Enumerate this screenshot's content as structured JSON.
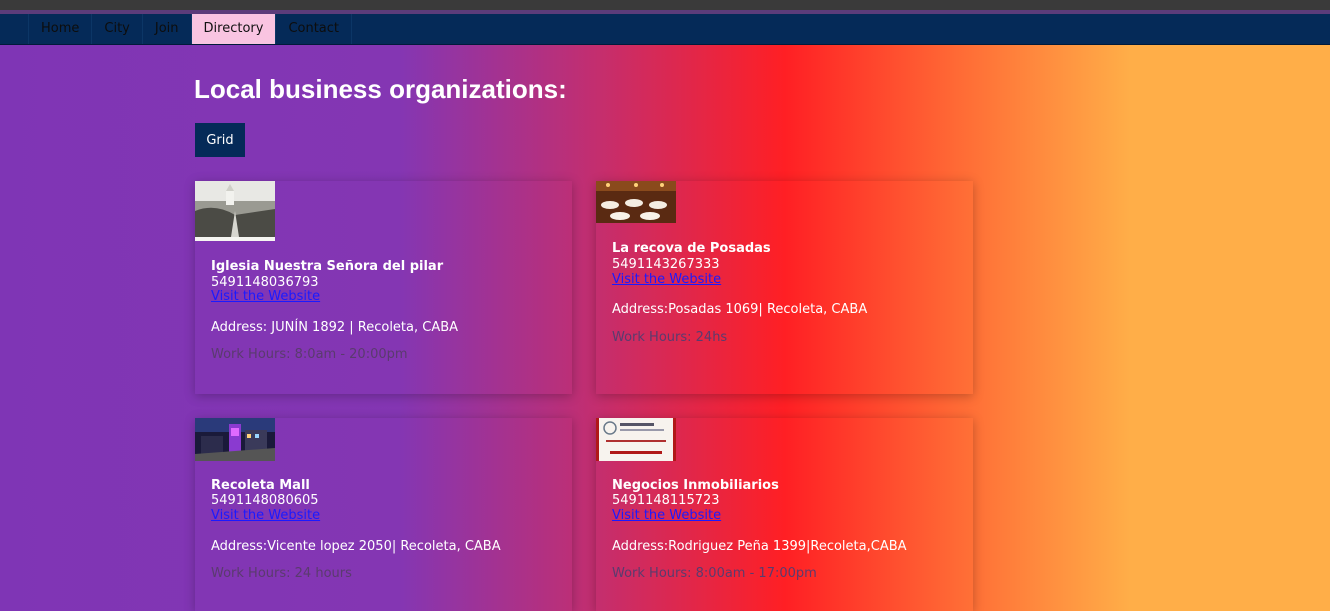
{
  "nav": {
    "items": [
      {
        "label": "Home"
      },
      {
        "label": "City"
      },
      {
        "label": "Join"
      },
      {
        "label": "Directory"
      },
      {
        "label": "Contact"
      }
    ],
    "active": "Directory"
  },
  "main": {
    "title": "Local business organizations:",
    "grid_button": "Grid"
  },
  "cards": [
    {
      "name": "Iglesia Nuestra Señora del pilar",
      "phone": "5491148036793",
      "link": "Visit the Website",
      "address": "Address: JUNÍN 1892 | Recoleta, CABA",
      "hours": "Work Hours: 8:0am - 20:00pm",
      "image": "church-photo"
    },
    {
      "name": "La recova de Posadas",
      "phone": "5491143267333",
      "link": "Visit the Website",
      "address": "Address:Posadas 1069| Recoleta, CABA",
      "hours": "Work Hours: 24hs",
      "image": "restaurant-photo"
    },
    {
      "name": "Recoleta Mall",
      "phone": "5491148080605",
      "link": "Visit the Website",
      "address": "Address:Vicente lopez 2050| Recoleta, CABA",
      "hours": "Work Hours: 24 hours",
      "image": "mall-photo"
    },
    {
      "name": "Negocios Inmobiliarios",
      "phone": "5491148115723",
      "link": "Visit the Website",
      "address": "Address:Rodriguez Peña 1399|Recoleta,CABA",
      "hours": "Work Hours: 8:00am - 17:00pm",
      "image": "real-estate-logo"
    }
  ],
  "colors": {
    "nav_bg": "#052a58",
    "nav_active": "#f9c4e1",
    "link": "#1a1aff",
    "gradient": [
      "#7f35b5",
      "#ff1f24",
      "#ffae48"
    ]
  }
}
